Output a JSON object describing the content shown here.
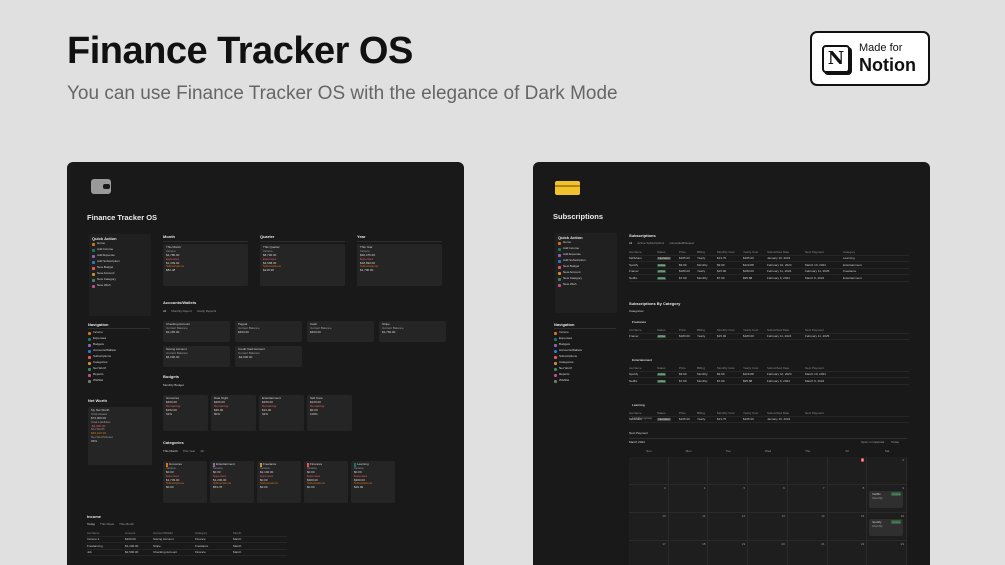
{
  "hero": {
    "title": "Finance Tracker OS",
    "subtitle": "You can use Finance Tracker OS with the elegance of Dark Mode"
  },
  "badge": {
    "logo_letter": "N",
    "made_for": "Made for",
    "brand": "Notion"
  },
  "left": {
    "page_title": "Finance Tracker OS",
    "quick_actions": {
      "title": "Quick Action",
      "items": [
        "Home",
        "Add Income",
        "Add Expense",
        "Add Subscription",
        "New Budget",
        "New Account",
        "New Category",
        "New Wish"
      ]
    },
    "navigation": {
      "title": "Navigation",
      "items": [
        "Income",
        "Expenses",
        "Budgets",
        "Accounts/Wallets",
        "Subscriptions",
        "Categories",
        "Net Worth",
        "Reports",
        "Wishlist"
      ]
    },
    "net_worth": {
      "title": "Net Worth",
      "card_title": "My Net Worth",
      "lines": [
        "Total Assets",
        "$74,000.00",
        "Total Liabilities",
        "-$4,900.00",
        "Net Worth",
        "$69,100.00",
        "Net Worth/Asset",
        "93%"
      ]
    },
    "periods": [
      {
        "title": "Month",
        "card": "This Month",
        "lines": [
          "Income",
          "$2,780.00",
          "Expenses",
          "$1,339.00",
          "Subscriptions",
          "$82.48"
        ]
      },
      {
        "title": "Quarter",
        "card": "This Quarter",
        "lines": [
          "Income",
          "$8,790.00",
          "Expenses",
          "$4,698.00",
          "Subscriptions",
          "$218.38"
        ]
      },
      {
        "title": "Year",
        "card": "This Year",
        "lines": [
          "Income",
          "$30,475.00",
          "Expenses",
          "$18,690.00",
          "Subscriptions",
          "$1,790.00"
        ]
      }
    ],
    "accounts": {
      "title": "Accounts/Wallets",
      "tabs": [
        "All",
        "Monthly Report",
        "Yearly Reports"
      ],
      "cards": [
        {
          "name": "Checking Account",
          "sub": "Current Balance",
          "value": "$2,165.00"
        },
        {
          "name": "Paypal",
          "sub": "Current Balance",
          "value": "$463.00"
        },
        {
          "name": "Cash",
          "sub": "Current Balance",
          "value": "$400.00"
        },
        {
          "name": "Stripe",
          "sub": "Current Balance",
          "value": "$1,782.00"
        },
        {
          "name": "Saving Account",
          "sub": "Current Balance",
          "value": "$6,000.00"
        },
        {
          "name": "Credit Card Account",
          "sub": "Current Balance",
          "value": "-$2,000.00"
        }
      ]
    },
    "budgets": {
      "title": "Budgets",
      "tabs": [
        "Monthly Budget"
      ],
      "cards": [
        {
          "name": "Groceries",
          "lines": [
            "$400.00",
            "Remaining",
            "$152.00",
            "62%"
          ]
        },
        {
          "name": "Date Night",
          "lines": [
            "$200.00",
            "Remaining",
            "$40.00",
            "80%"
          ]
        },
        {
          "name": "Entertainment",
          "lines": [
            "$150.00",
            "Remaining",
            "$12.00",
            "92%"
          ]
        },
        {
          "name": "Self Care",
          "lines": [
            "$120.00",
            "Remaining",
            "$0.00",
            "100%"
          ]
        }
      ]
    },
    "categories": {
      "title": "Categories",
      "tabs": [
        "This Month",
        "This Year",
        "All"
      ],
      "cards": [
        {
          "name": "Groceries",
          "lines": [
            "Income",
            "$0.00",
            "Expenses",
            "$1,739.00",
            "Subscriptions",
            "$0.00"
          ]
        },
        {
          "name": "Entertainment",
          "lines": [
            "Income",
            "$0.00",
            "Expenses",
            "$1,200.00",
            "Subscriptions",
            "$53.78"
          ]
        },
        {
          "name": "Freelance",
          "lines": [
            "Income",
            "$2,100.00",
            "Expenses",
            "$0.00",
            "Subscriptions",
            "$0.00"
          ]
        },
        {
          "name": "Finances",
          "lines": [
            "Income",
            "$0.00",
            "Expenses",
            "$900.00",
            "Subscriptions",
            "$0.00"
          ]
        },
        {
          "name": "Learning",
          "lines": [
            "Income",
            "$0.00",
            "Expenses",
            "$200.00",
            "Subscriptions",
            "$29.00"
          ]
        }
      ]
    },
    "income": {
      "title": "Income",
      "tabs": [
        "Today",
        "This Week",
        "This Month"
      ],
      "headers": [
        "Aa Name",
        "Amount",
        "Account/Wallet",
        "Category",
        "Month"
      ],
      "rows": [
        [
          "Income 2",
          "$100.00",
          "Saving Account",
          "Finance",
          "March"
        ],
        [
          "Freelancing",
          "$1,200.00",
          "Stripe",
          "Freelance",
          "March"
        ],
        [
          "Job",
          "$2,500.00",
          "Checking Account",
          "Finance",
          "March"
        ]
      ]
    }
  },
  "right": {
    "page_title": "Subscriptions",
    "quick_actions": {
      "title": "Quick Action",
      "items": [
        "Home",
        "Add Income",
        "Add Expense",
        "Add Subscription",
        "New Budget",
        "New Account",
        "New Category",
        "New Wish"
      ]
    },
    "navigation": {
      "title": "Navigation",
      "items": [
        "Income",
        "Expenses",
        "Budgets",
        "Accounts/Wallets",
        "Subscriptions",
        "Categories",
        "Net Worth",
        "Reports",
        "Wishlist"
      ]
    },
    "subscriptions": {
      "title": "Subscriptions",
      "tabs": [
        "All",
        "Active Subscriptions",
        "Cancelled/Paused"
      ],
      "headers": [
        "Aa Name",
        "Status",
        "Price",
        "Billing",
        "Monthly Cost",
        "Yearly Cost",
        "Subscribed Date",
        "Next Payment",
        "Category"
      ],
      "rows": [
        [
          "Skillshare",
          "Cancelled",
          "$165.00",
          "Yearly",
          "$13.75",
          "$165.00",
          "January 10, 2024",
          "",
          "Learning"
        ],
        [
          "Spotify",
          "Active",
          "$9.99",
          "Monthly",
          "$9.99",
          "$119.88",
          "February 10, 2024",
          "March 10, 2024",
          "Entertainment"
        ],
        [
          "Framer",
          "Active",
          "$180.00",
          "Yearly",
          "$15.00",
          "$180.00",
          "February 11, 2024",
          "February 11, 2025",
          "Freelance"
        ],
        [
          "Netflix",
          "Active",
          "$7.99",
          "Monthly",
          "$7.99",
          "$95.88",
          "February 9, 2024",
          "March 9, 2024",
          "Entertainment"
        ]
      ]
    },
    "by_category": {
      "title": "Subscriptions By Category",
      "tabs": [
        "Categories"
      ],
      "groups": [
        {
          "name": "Freelance",
          "rows": [
            [
              "Framer",
              "Active",
              "$180.00",
              "Yearly",
              "$15.00",
              "$180.00",
              "February 11, 2024",
              "February 11, 2025"
            ]
          ]
        },
        {
          "name": "Entertainment",
          "rows": [
            [
              "Spotify",
              "Active",
              "$9.99",
              "Monthly",
              "$9.99",
              "$119.88",
              "February 10, 2024",
              "March 10, 2024"
            ],
            [
              "Netflix",
              "Active",
              "$7.99",
              "Monthly",
              "$7.99",
              "$95.88",
              "February 9, 2024",
              "March 9, 2024"
            ]
          ]
        },
        {
          "name": "Learning",
          "rows": [
            [
              "Skillshare",
              "Cancelled",
              "$165.00",
              "Yearly",
              "$13.75",
              "$165.00",
              "January 10, 2024",
              ""
            ]
          ]
        }
      ],
      "hidden": "1 hidden group"
    },
    "calendar": {
      "tab": "Next Payment",
      "month": "March 2024",
      "open_in_calendar": "Open in Calendar",
      "today": "Today",
      "days": [
        "Sun",
        "Mon",
        "Tue",
        "Wed",
        "Thu",
        "Fri",
        "Sat"
      ],
      "dates": [
        "",
        "",
        "",
        "",
        "",
        "1",
        "2",
        "3",
        "4",
        "5",
        "6",
        "7",
        "8",
        "9",
        "10",
        "11",
        "12",
        "13",
        "14",
        "15",
        "16",
        "17",
        "18",
        "19",
        "20",
        "21",
        "22",
        "23"
      ],
      "events": [
        {
          "date": "9",
          "name": "Netflix",
          "status": "Active",
          "billing": "Monthly"
        },
        {
          "date": "16",
          "name": "Spotify",
          "status": "Active",
          "billing": "Monthly"
        }
      ]
    }
  },
  "colors": {
    "background": "#e0e0e0",
    "panel": "#191919",
    "card": "#252525",
    "active_green": "#2f5e3f",
    "cancelled_gray": "#454545",
    "accent_orange": "#d9730d",
    "today_red": "#eb5757"
  }
}
